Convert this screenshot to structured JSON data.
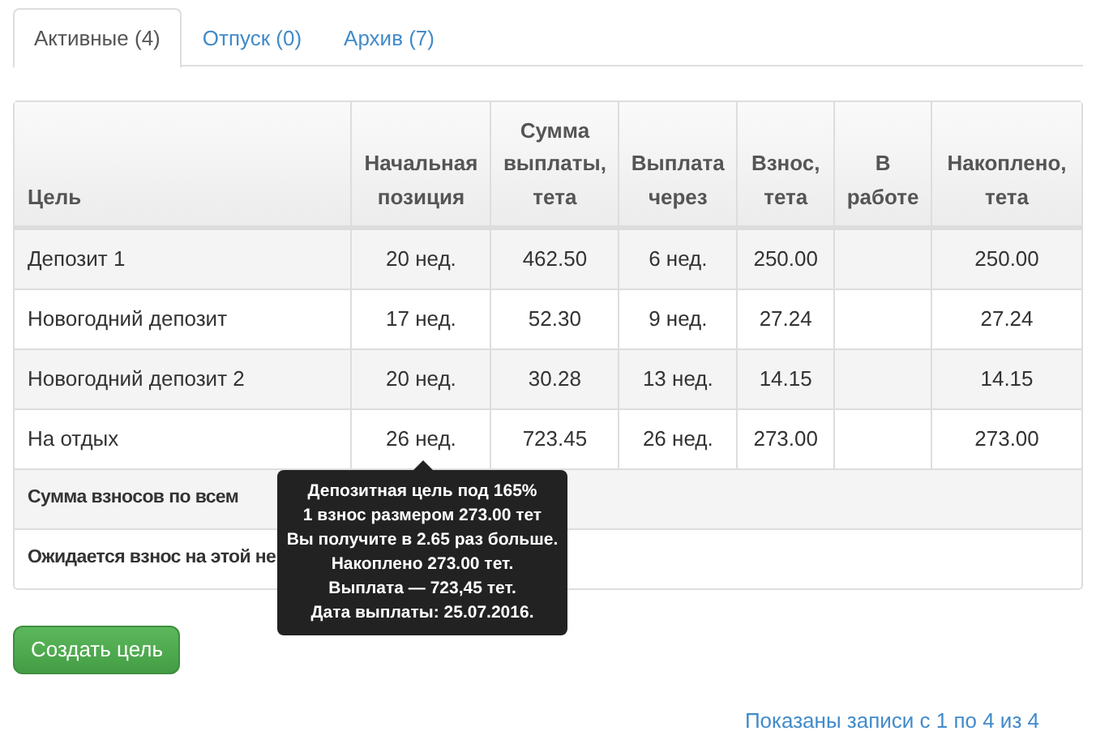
{
  "tabs": [
    {
      "label": "Активные (4)",
      "selected": true
    },
    {
      "label": "Отпуск (0)",
      "selected": false
    },
    {
      "label": "Архив (7)",
      "selected": false
    }
  ],
  "table": {
    "columns": [
      "Цель",
      "Начальная позиция",
      "Сумма выплаты, тета",
      "Выплата через",
      "Взнос, тета",
      "В работе",
      "Накоплено, тета"
    ],
    "rows": [
      {
        "cells": [
          "Депозит 1",
          "20 нед.",
          "462.50",
          "6 нед.",
          "250.00",
          "",
          "250.00"
        ]
      },
      {
        "cells": [
          "Новогодний депозит",
          "17 нед.",
          "52.30",
          "9 нед.",
          "27.24",
          "",
          "27.24"
        ]
      },
      {
        "cells": [
          "Новогодний депозит 2",
          "20 нед.",
          "30.28",
          "13 нед.",
          "14.15",
          "",
          "14.15"
        ]
      },
      {
        "cells": [
          "На отдых",
          "26 нед.",
          "723.45",
          "26 нед.",
          "273.00",
          "",
          "273.00"
        ]
      }
    ],
    "summary": [
      {
        "text": "Сумма взносов по всем"
      },
      {
        "text": "Ожидается взнос на этой не"
      }
    ]
  },
  "tooltip": {
    "lines": [
      "Депозитная цель под 165%",
      "1 взнос размером 273.00 тет",
      "Вы получите в 2.65 раз больше.",
      "Накоплено 273.00 тет.",
      "Выплата — 723,45 тет.",
      "Дата выплаты: 25.07.2016."
    ]
  },
  "create_button": "Создать цель",
  "footer": "Показаны записи с 1 по 4 из 4"
}
